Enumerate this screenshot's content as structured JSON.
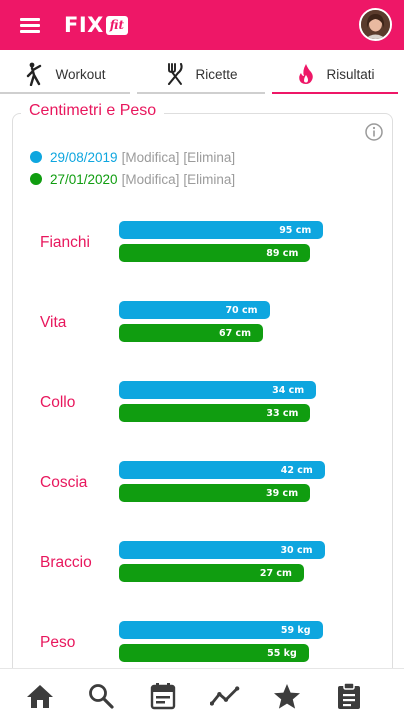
{
  "header": {
    "logo_text": "FIX",
    "logo_badge": "fit",
    "brand_color": "#ee1767"
  },
  "tabs": [
    {
      "label": "Workout",
      "icon": "workout-icon",
      "active": false
    },
    {
      "label": "Ricette",
      "icon": "fork-knife-icon",
      "active": false
    },
    {
      "label": "Risultati",
      "icon": "flame-icon",
      "active": true
    }
  ],
  "card": {
    "title": "Centimetri e Peso",
    "legend": [
      {
        "date": "29/08/2019",
        "color": "#0ea6df",
        "edit_label": "[Modifica]",
        "delete_label": "[Elimina]"
      },
      {
        "date": "27/01/2020",
        "color": "#109d10",
        "edit_label": "[Modifica]",
        "delete_label": "[Elimina]"
      }
    ]
  },
  "chart_data": {
    "type": "bar",
    "categories": [
      "Fianchi",
      "Vita",
      "Collo",
      "Coscia",
      "Braccio",
      "Peso"
    ],
    "series": [
      {
        "name": "29/08/2019",
        "color": "#0ea6df",
        "values": [
          95,
          70,
          34,
          42,
          30,
          59
        ],
        "labels": [
          "95 cm",
          "70 cm",
          "34 cm",
          "42 cm",
          "30 cm",
          "59 kg"
        ]
      },
      {
        "name": "27/01/2020",
        "color": "#109d10",
        "values": [
          89,
          67,
          33,
          39,
          27,
          55
        ],
        "labels": [
          "89 cm",
          "67 cm",
          "33 cm",
          "39 cm",
          "27 cm",
          "55 kg"
        ]
      }
    ]
  },
  "bottom_nav": [
    {
      "icon": "home-icon"
    },
    {
      "icon": "search-icon"
    },
    {
      "icon": "calendar-icon"
    },
    {
      "icon": "trend-icon"
    },
    {
      "icon": "star-icon"
    },
    {
      "icon": "clipboard-icon"
    }
  ]
}
